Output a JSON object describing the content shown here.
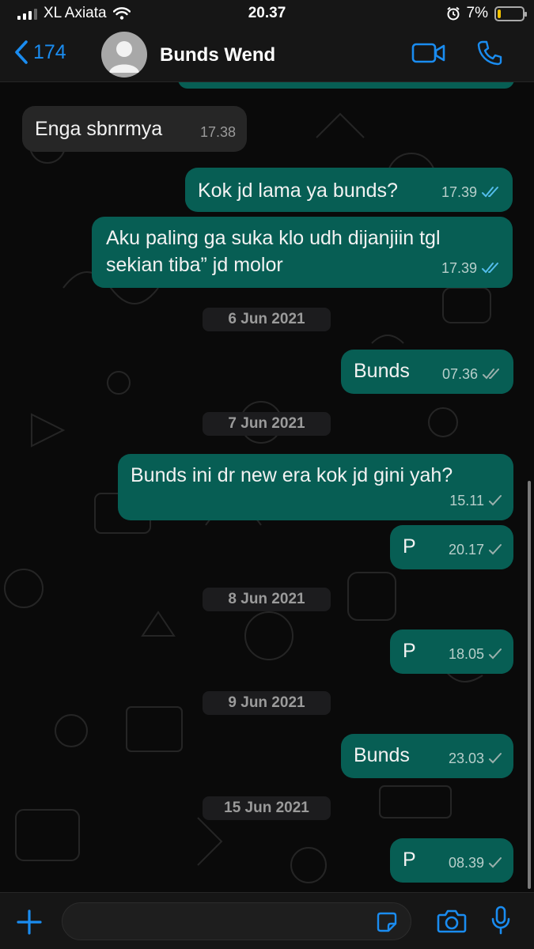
{
  "status_bar": {
    "carrier": "XL Axiata",
    "time": "20.37",
    "battery": "7%"
  },
  "header": {
    "back_count": "174",
    "contact_name": "Bunds Wend"
  },
  "messages": [
    {
      "dir": "in",
      "text": "Enga sbnrmya",
      "time": "17.38"
    },
    {
      "dir": "out",
      "text": "Kok jd lama ya bunds?",
      "time": "17.39",
      "status": "read"
    },
    {
      "dir": "out",
      "text": "Aku paling ga suka klo udh dijanjiin tgl sekian tiba” jd molor",
      "time": "17.39",
      "status": "read"
    },
    {
      "dir": "out",
      "text": "Bunds",
      "time": "07.36",
      "status": "delivered"
    },
    {
      "dir": "out",
      "text": "Bunds ini dr new era kok jd gini yah?",
      "time": "15.11",
      "status": "sent"
    },
    {
      "dir": "out",
      "text": "P",
      "time": "20.17",
      "status": "sent"
    },
    {
      "dir": "out",
      "text": "P",
      "time": "18.05",
      "status": "sent"
    },
    {
      "dir": "out",
      "text": "Bunds",
      "time": "23.03",
      "status": "sent"
    },
    {
      "dir": "out",
      "text": "P",
      "time": "08.39",
      "status": "sent"
    }
  ],
  "dates": [
    "6 Jun 2021",
    "7 Jun 2021",
    "8 Jun 2021",
    "9 Jun 2021",
    "15 Jun 2021"
  ],
  "icons": {
    "back": "chevron-left-icon",
    "avatar": "person-icon",
    "video": "video-camera-icon",
    "call": "phone-icon",
    "attach": "plus-icon",
    "sticker": "sticker-icon",
    "camera": "camera-icon",
    "mic": "microphone-icon",
    "read": "double-check-icon",
    "sent": "single-check-icon"
  },
  "colors": {
    "accent": "#1a8cf0",
    "outgoing_bubble": "#075e54",
    "incoming_bubble": "#262626",
    "read_tick": "#53bdeb"
  }
}
